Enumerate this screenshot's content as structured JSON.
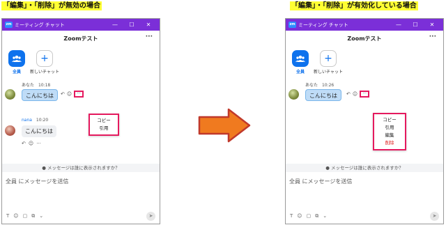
{
  "captions": {
    "left": "「編集」・「削除」が無効の場合",
    "right": "「編集」・「削除」が有効化している場合"
  },
  "window": {
    "logo": "zm",
    "title": "ミーティング チャット",
    "minimize": "—",
    "maximize": "☐",
    "close": "✕",
    "chat_title": "Zoomテスト",
    "header_more": "···"
  },
  "members": {
    "all_label": "全員",
    "all_icon": "people-icon",
    "new_label": "新しいチャット",
    "new_icon": "+"
  },
  "left": {
    "msg1": {
      "sender": "あなた",
      "time": "10:18",
      "text": "こんにちは"
    },
    "msg2": {
      "sender": "nana",
      "time": "10:20",
      "text": "こんにちは"
    },
    "menu": [
      "コピー",
      "引用"
    ]
  },
  "right": {
    "msg1": {
      "sender": "あなた",
      "time": "10:26",
      "text": "こんにちは"
    },
    "menu": [
      "コピー",
      "引用",
      "編集",
      "削除"
    ]
  },
  "icons": {
    "reply": "↶",
    "emoji": "☺",
    "more": "···",
    "person": "👤"
  },
  "notice": "メッセージは誰に表示されますか？",
  "input_placeholder": "全員 にメッセージを送信",
  "toolbar": {
    "text_format": "T",
    "emoji": "☺",
    "file": "▢",
    "screenshot": "⧉",
    "chevron": "⌄",
    "send": "➤"
  },
  "colors": {
    "titlebar": "#7b2fd8",
    "accent": "#0e72ed",
    "highlight": "#e5195e",
    "caption_bg": "#ffff33",
    "arrow_fill": "#f07a1f",
    "delete": "#e02020"
  }
}
